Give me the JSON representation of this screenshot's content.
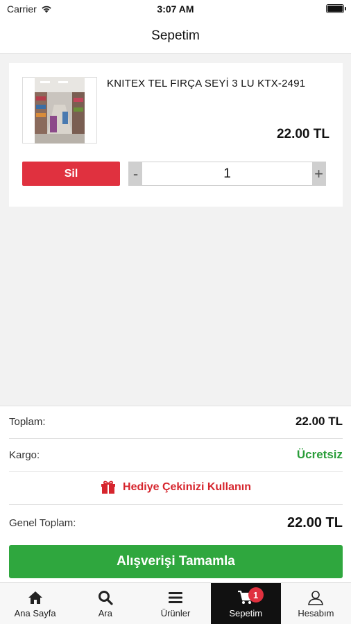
{
  "status_bar": {
    "carrier": "Carrier",
    "time": "3:07 AM"
  },
  "nav": {
    "title": "Sepetim"
  },
  "cart_item": {
    "name": "KNITEX TEL FIRÇA SEYİ 3 LU KTX-2491",
    "price": "22.00 TL",
    "remove_label": "Sil",
    "qty_minus": "-",
    "qty_plus": "+",
    "quantity": "1",
    "image_icon": "product-photo"
  },
  "summary": {
    "subtotal_label": "Toplam:",
    "subtotal_value": "22.00 TL",
    "shipping_label": "Kargo:",
    "shipping_value": "Ücretsiz",
    "gift_label": "Hediye Çekinizi Kullanın",
    "grand_total_label": "Genel Toplam:",
    "grand_total_value": "22.00 TL",
    "checkout_label": "Alışverişi Tamamla"
  },
  "tabs": [
    {
      "label": "Ana Sayfa",
      "icon": "home-icon"
    },
    {
      "label": "Ara",
      "icon": "search-icon"
    },
    {
      "label": "Ürünler",
      "icon": "menu-icon"
    },
    {
      "label": "Sepetim",
      "icon": "cart-icon",
      "badge": "1",
      "active": true
    },
    {
      "label": "Hesabım",
      "icon": "user-icon"
    }
  ],
  "colors": {
    "accent_red": "#e0313f",
    "accent_green": "#2fa73e",
    "free_green": "#2a9d3a",
    "active_tab": "#111111"
  }
}
